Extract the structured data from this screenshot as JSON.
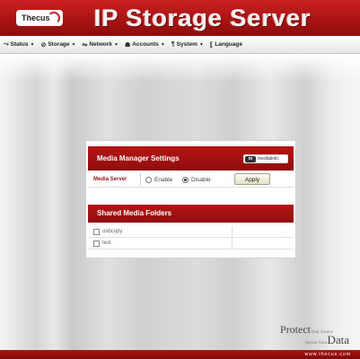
{
  "header": {
    "logo_text": "Thecus",
    "title": "IP Storage Server"
  },
  "menu": [
    {
      "label": "Status",
      "icon": "status-icon"
    },
    {
      "label": "Storage",
      "icon": "storage-icon"
    },
    {
      "label": "Network",
      "icon": "network-icon"
    },
    {
      "label": "Accounts",
      "icon": "accounts-icon"
    },
    {
      "label": "System",
      "icon": "system-icon"
    },
    {
      "label": "Language",
      "icon": "language-icon"
    }
  ],
  "media_manager": {
    "title": "Media Manager Settings",
    "logo_text": "mediabolic",
    "row_label": "Media Server",
    "enable_label": "Enable",
    "disable_label": "Disable",
    "selected": "Disable",
    "apply_label": "Apply"
  },
  "shared_folders": {
    "title": "Shared Media Folders",
    "folders": [
      {
        "name": "usbcopy",
        "checked": false
      },
      {
        "name": "test",
        "checked": false
      }
    ]
  },
  "slogan": {
    "line1_big": "Protect",
    "line1_small": "Your Source",
    "line2_small": "Secure Your",
    "line2_big": "Data"
  },
  "footer": {
    "url": "www.thecus.com"
  },
  "colors": {
    "brand_red": "#a81212",
    "apply_button": "#ecebd6"
  }
}
